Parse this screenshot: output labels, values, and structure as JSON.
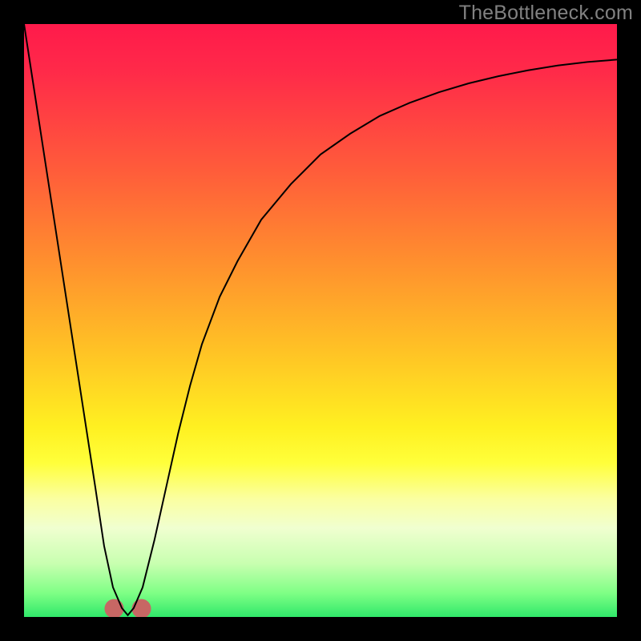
{
  "watermark": "TheBottleneck.com",
  "chart_data": {
    "type": "line",
    "title": "",
    "xlabel": "",
    "ylabel": "",
    "xlim": [
      0,
      100
    ],
    "ylim": [
      0,
      100
    ],
    "grid": false,
    "gradient_stops": [
      {
        "offset": 0,
        "color": "#ff1a4b"
      },
      {
        "offset": 0.08,
        "color": "#ff2a49"
      },
      {
        "offset": 0.25,
        "color": "#ff5d3a"
      },
      {
        "offset": 0.4,
        "color": "#ff8f2e"
      },
      {
        "offset": 0.55,
        "color": "#ffc225"
      },
      {
        "offset": 0.68,
        "color": "#fff021"
      },
      {
        "offset": 0.74,
        "color": "#ffff3a"
      },
      {
        "offset": 0.8,
        "color": "#fbffa0"
      },
      {
        "offset": 0.85,
        "color": "#f0ffd0"
      },
      {
        "offset": 0.91,
        "color": "#c8ffb0"
      },
      {
        "offset": 0.96,
        "color": "#7eff85"
      },
      {
        "offset": 1.0,
        "color": "#30e86a"
      }
    ],
    "series": [
      {
        "name": "bottleneck-curve",
        "x": [
          0,
          2,
          4,
          6,
          8,
          10,
          12,
          13.5,
          15,
          16.5,
          17.5,
          18.5,
          20,
          22,
          24,
          26,
          28,
          30,
          33,
          36,
          40,
          45,
          50,
          55,
          60,
          65,
          70,
          75,
          80,
          85,
          90,
          95,
          100
        ],
        "y": [
          100,
          87,
          74,
          61,
          48,
          35,
          22,
          12,
          5,
          1.5,
          0.3,
          1.5,
          5,
          13,
          22,
          31,
          39,
          46,
          54,
          60,
          67,
          73,
          78,
          81.5,
          84.5,
          86.7,
          88.5,
          90,
          91.2,
          92.2,
          93,
          93.6,
          94
        ]
      }
    ],
    "markers": {
      "name": "bottom-lobes",
      "points": [
        {
          "x": 15.2,
          "y": 1.4
        },
        {
          "x": 19.8,
          "y": 1.4
        }
      ],
      "radius_px": 12,
      "color": "#c76764"
    }
  }
}
